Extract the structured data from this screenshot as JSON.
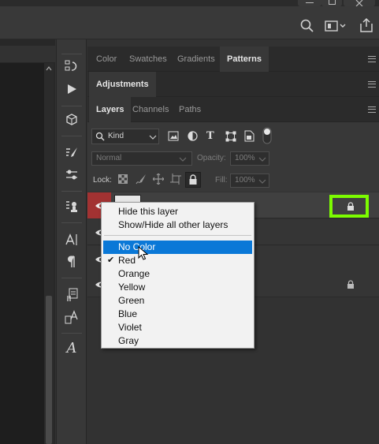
{
  "window": {
    "minimize_icon": "minimize-icon",
    "restore_icon": "restore-icon",
    "close_icon": "close-icon"
  },
  "options_bar": {
    "icons": [
      "search-icon",
      "workspace-icon",
      "share-icon"
    ]
  },
  "collapse_left": "«",
  "collapse_right": "»",
  "panel_groups": [
    {
      "tabs": [
        "Color",
        "Swatches",
        "Gradients",
        "Patterns"
      ],
      "active": "Patterns"
    },
    {
      "tabs": [
        "Adjustments"
      ],
      "active": "Adjustments"
    },
    {
      "tabs": [
        "Layers",
        "Channels",
        "Paths"
      ],
      "active": "Layers"
    }
  ],
  "layers_panel": {
    "filter_kind": "Kind",
    "blend_mode": "Normal",
    "opacity_label": "Opacity:",
    "opacity_value": "100%",
    "lock_label": "Lock:",
    "fill_label": "Fill:",
    "fill_value": "100%"
  },
  "label_color": {
    "red": "#a23232",
    "highlight_outline": "#7cfc00"
  },
  "context_menu": {
    "items": [
      {
        "label": "Hide this layer"
      },
      {
        "label": "Show/Hide all other layers"
      },
      {
        "label": "No Color",
        "highlighted": true
      },
      {
        "label": "Red",
        "checked": true
      },
      {
        "label": "Orange"
      },
      {
        "label": "Yellow"
      },
      {
        "label": "Green"
      },
      {
        "label": "Blue"
      },
      {
        "label": "Violet"
      },
      {
        "label": "Gray"
      }
    ],
    "check_glyph": "✔"
  }
}
